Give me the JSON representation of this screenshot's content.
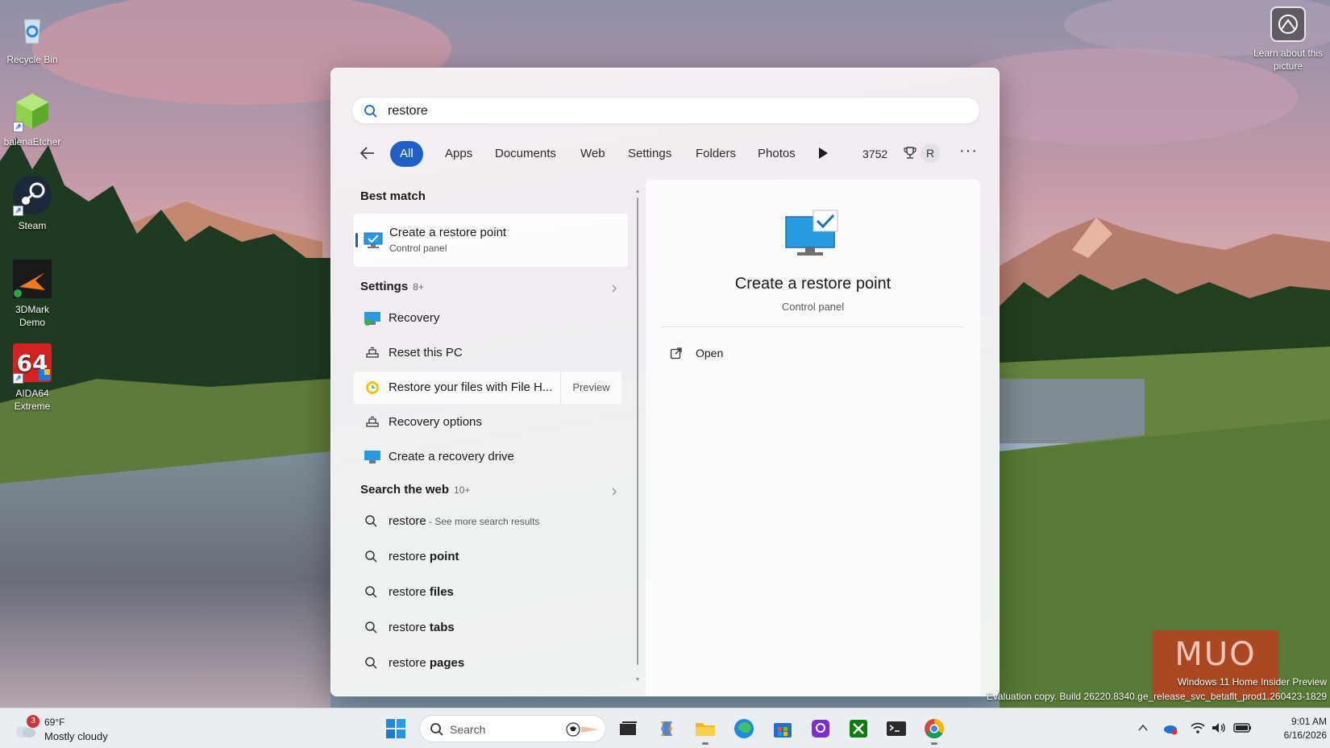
{
  "desktop": {
    "icons": [
      {
        "label": "Recycle Bin"
      },
      {
        "label": "balenaEtcher"
      },
      {
        "label": "Steam"
      },
      {
        "label": "3DMark Demo"
      },
      {
        "label": "AIDA64 Extreme"
      }
    ],
    "learn_picture": "Learn about this picture"
  },
  "search": {
    "query": "restore",
    "filters": [
      "All",
      "Apps",
      "Documents",
      "Web",
      "Settings",
      "Folders",
      "Photos"
    ],
    "active_filter": "All",
    "points": "3752",
    "avatar_initial": "R",
    "more": "···"
  },
  "results": {
    "best_match_heading": "Best match",
    "best_match": {
      "title": "Create a restore point",
      "subtitle": "Control panel"
    },
    "settings_heading": "Settings",
    "settings_count": "8+",
    "settings_items": [
      {
        "label": "Recovery",
        "icon": "monitor-icon"
      },
      {
        "label": "Reset this PC",
        "icon": "recovery-icon"
      },
      {
        "label": "Restore your files with File H...",
        "icon": "file-history-icon",
        "preview": "Preview"
      },
      {
        "label": "Recovery options",
        "icon": "recovery-icon"
      },
      {
        "label": "Create a recovery drive",
        "icon": "monitor-icon"
      }
    ],
    "web_heading": "Search the web",
    "web_count": "10+",
    "web_items": [
      {
        "prefix": "restore",
        "bold": "",
        "hint": " - See more search results"
      },
      {
        "prefix": "restore ",
        "bold": "point",
        "hint": ""
      },
      {
        "prefix": "restore ",
        "bold": "files",
        "hint": ""
      },
      {
        "prefix": "restore ",
        "bold": "tabs",
        "hint": ""
      },
      {
        "prefix": "restore ",
        "bold": "pages",
        "hint": ""
      }
    ]
  },
  "preview": {
    "title": "Create a restore point",
    "subtitle": "Control panel",
    "action": "Open"
  },
  "watermark": {
    "brand": "MUO",
    "edition": "Windows 11 Home Insider Preview",
    "build": "Evaluation copy. Build 26220.8340.ge_release_svc_betaflt_prod1.260423-1829"
  },
  "taskbar": {
    "weather_badge": "3",
    "temperature": "69°F",
    "condition": "Mostly cloudy",
    "search_label": "Search",
    "time": "9:01 AM",
    "date": "6/16/2026"
  },
  "colors": {
    "accent": "#1f5fc6",
    "panel_bg": "#f2eef2",
    "taskbar_bg": "#eaeef2"
  }
}
